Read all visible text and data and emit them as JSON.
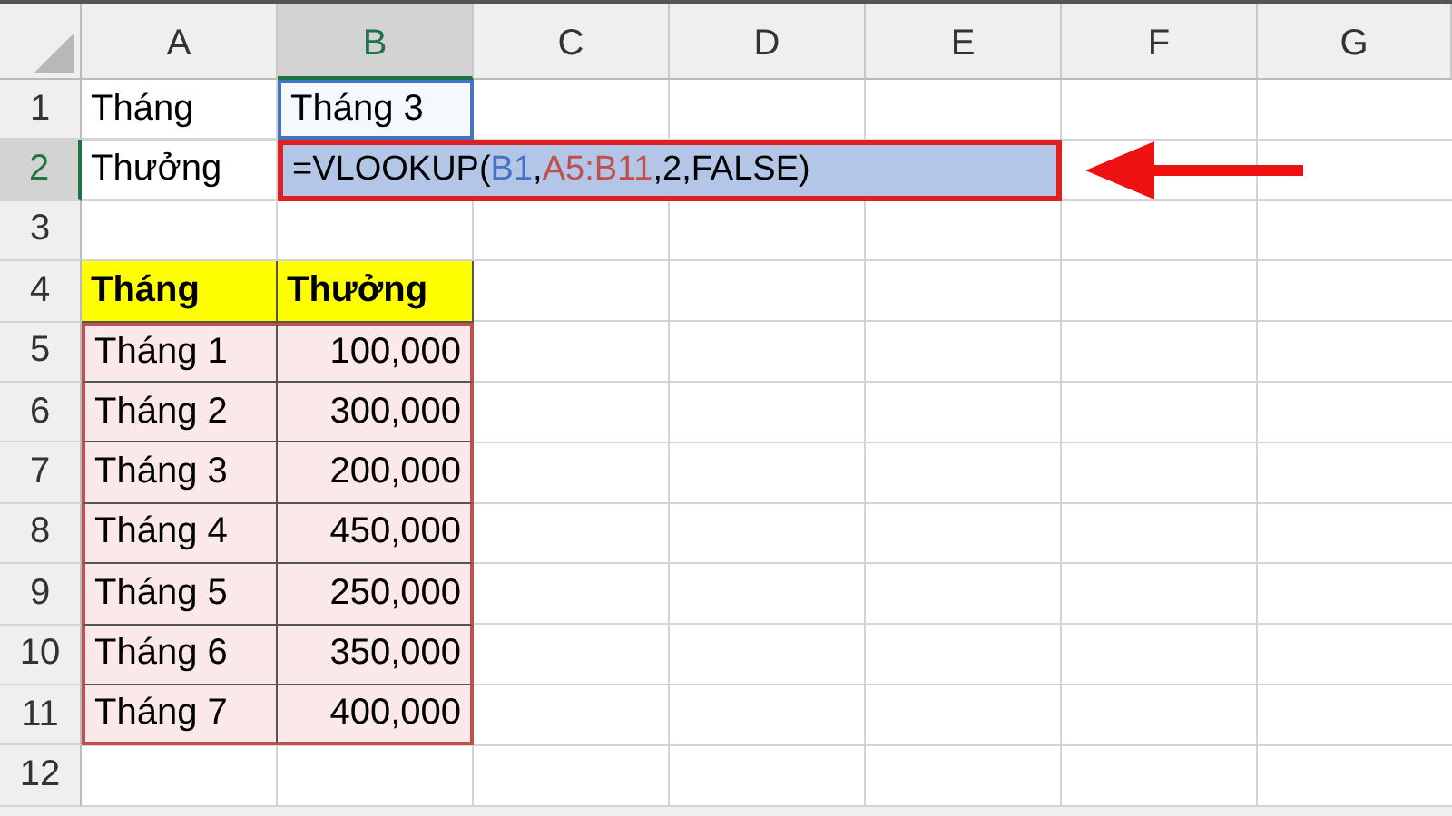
{
  "columns": [
    {
      "label": "A",
      "selected": false
    },
    {
      "label": "B",
      "selected": true
    },
    {
      "label": "C",
      "selected": false
    },
    {
      "label": "D",
      "selected": false
    },
    {
      "label": "E",
      "selected": false
    },
    {
      "label": "F",
      "selected": false
    },
    {
      "label": "G",
      "selected": false
    }
  ],
  "rows": [
    {
      "number": "1",
      "selected": false,
      "cells": [
        {
          "kind": "label",
          "text": "Tháng"
        },
        {
          "kind": "reference",
          "text": "Tháng 3"
        }
      ]
    },
    {
      "number": "2",
      "selected": true,
      "cells": [
        {
          "kind": "label",
          "text": "Thưởng"
        },
        {
          "kind": "formula",
          "parts": [
            {
              "text": "=VLOOKUP(",
              "color": "#000000"
            },
            {
              "text": "B1",
              "color": "#4472c4"
            },
            {
              "prefix": ",",
              "text": "A5:B11",
              "color": "#c0504d"
            },
            {
              "text": ",2,FALSE)",
              "color": "#000000"
            }
          ]
        }
      ]
    },
    {
      "number": "3",
      "selected": false
    },
    {
      "number": "4",
      "selected": false,
      "cells": [
        {
          "kind": "header",
          "text": "Tháng"
        },
        {
          "kind": "header",
          "text": "Thưởng"
        }
      ]
    },
    {
      "number": "5",
      "selected": false,
      "cells": [
        {
          "kind": "range-text",
          "text": "Tháng 1"
        },
        {
          "kind": "range-number",
          "text": "100,000"
        }
      ]
    },
    {
      "number": "6",
      "selected": false,
      "cells": [
        {
          "kind": "range-text",
          "text": "Tháng 2"
        },
        {
          "kind": "range-number",
          "text": "300,000"
        }
      ]
    },
    {
      "number": "7",
      "selected": false,
      "cells": [
        {
          "kind": "range-text",
          "text": "Tháng 3"
        },
        {
          "kind": "range-number",
          "text": "200,000"
        }
      ]
    },
    {
      "number": "8",
      "selected": false,
      "cells": [
        {
          "kind": "range-text",
          "text": "Tháng 4"
        },
        {
          "kind": "range-number",
          "text": "450,000"
        }
      ]
    },
    {
      "number": "9",
      "selected": false,
      "cells": [
        {
          "kind": "range-text",
          "text": "Tháng 5"
        },
        {
          "kind": "range-number",
          "text": "250,000"
        }
      ]
    },
    {
      "number": "10",
      "selected": false,
      "cells": [
        {
          "kind": "range-text",
          "text": "Tháng 6"
        },
        {
          "kind": "range-number",
          "text": "350,000"
        }
      ]
    },
    {
      "number": "11",
      "selected": false,
      "cells": [
        {
          "kind": "range-text",
          "text": "Tháng 7"
        },
        {
          "kind": "range-number",
          "text": "400,000"
        }
      ]
    },
    {
      "number": "12",
      "selected": false
    }
  ]
}
